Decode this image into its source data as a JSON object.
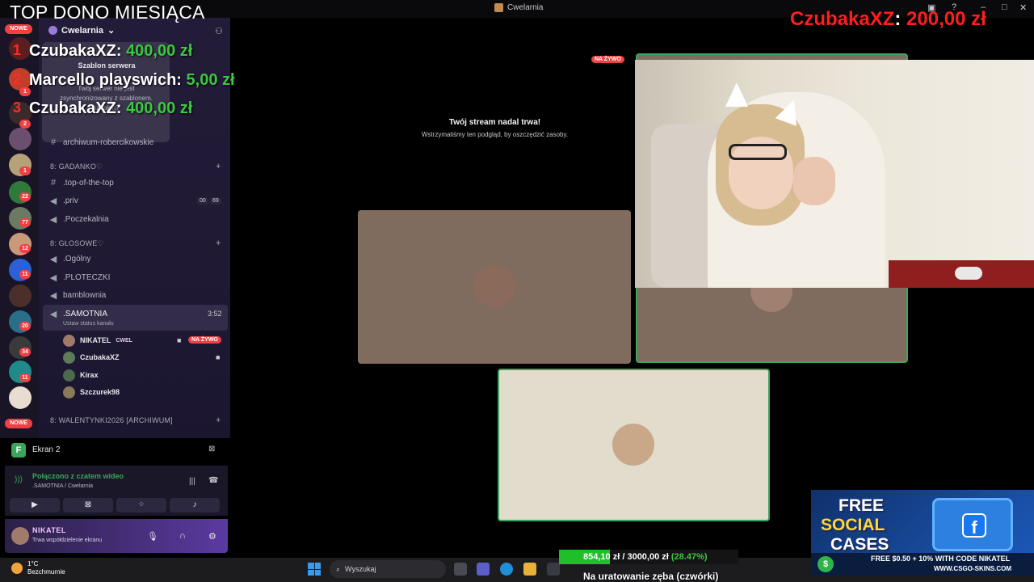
{
  "window": {
    "title": "Cwelarnia"
  },
  "overlay": {
    "top_dono_title": "TOP DONO MIESIĄCA",
    "donors": [
      {
        "rank": "1",
        "name": "CzubakaXZ",
        "amount": "400,00 zł"
      },
      {
        "rank": "2",
        "name": "Marcello playswich",
        "amount": "5,00 zł"
      },
      {
        "rank": "3",
        "name": "CzubakaXZ",
        "amount": "400,00 zł"
      }
    ],
    "last_dono": {
      "name": "CzubakaXZ",
      "sep": ":",
      "amount": "200,00 zł"
    }
  },
  "rail": {
    "nowe_label": "NOWE",
    "badges": [
      "1",
      "1",
      "2",
      "1",
      "22",
      "77",
      "12",
      "11",
      "20",
      "34",
      "11"
    ]
  },
  "sidebar": {
    "server_name": "Cwelarnia",
    "template_popup": {
      "title": "Szablon serwera",
      "body": "Twój serwer nie jest zsynchronizowany z szablonem. szablon?"
    },
    "channels_top": [
      {
        "label": "archiwum-robercikowskie"
      }
    ],
    "categories": [
      {
        "label": "8: GADANKO♡"
      },
      {
        "label": "8: GŁOSOWE♡"
      },
      {
        "label": "8: WALENTYNKI2026 [ARCHIWUM]"
      }
    ],
    "gadanko_channels": [
      {
        "label": ".top-of-the-top"
      },
      {
        "label": ".priv",
        "count_a": "00",
        "count_b": "69"
      },
      {
        "label": ".Poczekalnia"
      }
    ],
    "voice_channels": [
      {
        "label": ".Ogólny"
      },
      {
        "label": ".PLOTECZKI"
      },
      {
        "label": "bamblownia"
      },
      {
        "label": ".SAMOTNIA",
        "time": "3:52",
        "status": "Ustaw status kanału"
      }
    ],
    "members": [
      {
        "name": "NIKATEL",
        "tag": "CWEL",
        "live": "NA ŻYWO"
      },
      {
        "name": "CzubakaXZ"
      },
      {
        "name": "Kirax"
      },
      {
        "name": "Szczurek98"
      }
    ]
  },
  "screen_share": {
    "label": "Ekran 2"
  },
  "voice": {
    "status": "Połączono z czatem wideo",
    "location": ".SAMOTNIA / Cwelarnia"
  },
  "user": {
    "name": "NIKATEL",
    "status": "Trwa współdzielenie ekranu"
  },
  "stage": {
    "live_label": "NA ŻYWO",
    "message_title": "Twój stream nadal trwa!",
    "message_sub": "Wstrzymaliśmy ten podgląd, by oszczędzić zasoby."
  },
  "ad": {
    "line1": "FREE",
    "line2": "SOCIAL",
    "line3": "CASES",
    "code_text": "FREE $0.50 + 10% WITH CODE NIKATEL",
    "site": "WWW.CSGO-SKINS.COM"
  },
  "goal": {
    "current": "854,10 zł",
    "sep": "/",
    "target": "3000,00 zł",
    "percent_text": "(28.47%)",
    "progress": 0.2847,
    "caption": "Na uratowanie zęba (czwórki)"
  },
  "taskbar": {
    "temp": "1°C",
    "weather": "Bezchmurnie",
    "search_placeholder": "Wyszukaj"
  },
  "colors": {
    "accent_green": "#3ba55c",
    "live_red": "#ed4245",
    "dono_red": "#ff1e1e"
  }
}
